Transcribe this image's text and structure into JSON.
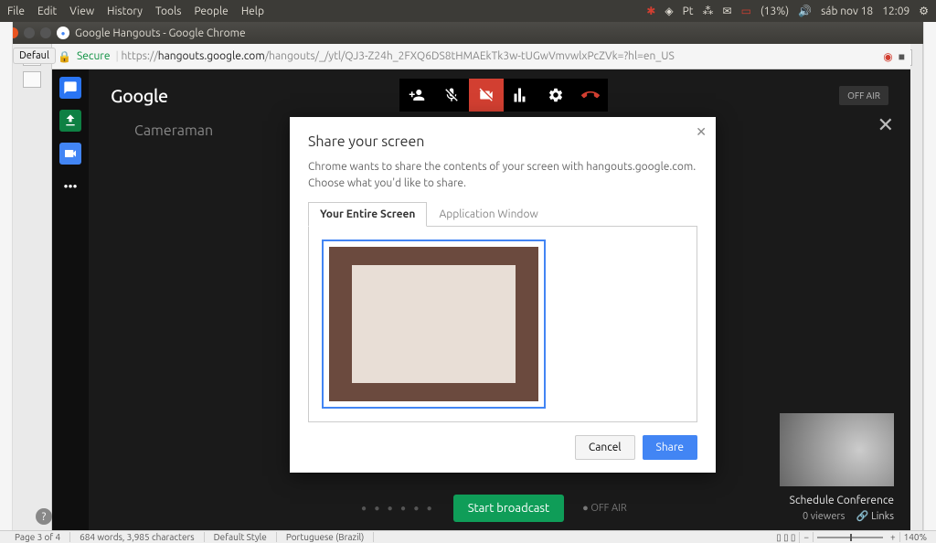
{
  "menubar": {
    "items": [
      "File",
      "Edit",
      "View",
      "History",
      "Tools",
      "People",
      "Help"
    ],
    "battery": "(13%)",
    "date": "sáb nov 18",
    "time": "12:09",
    "lang": "Pt"
  },
  "window": {
    "title": "Google Hangouts - Google Chrome"
  },
  "url": {
    "secure": "Secure",
    "prefix": "https://",
    "domain": "hangouts.google.com",
    "path": "/hangouts/_/ytl/QJ3-Z24h_2FXQ6DS8tHMAEkTk3w-tUGwVmvwlxPcZVk=?hl=en_US"
  },
  "lefttab": "Defaul",
  "app": {
    "logo": "Google",
    "offair": "OFF AIR",
    "cameraman": "Cameraman",
    "start": "Start broadcast",
    "offair2": "OFF AIR",
    "schedule": "Schedule Conference",
    "viewers": "0 viewers",
    "links": "Links"
  },
  "dialog": {
    "title": "Share your screen",
    "desc": "Chrome wants to share the contents of your screen with hangouts.google.com. Choose what you'd like to share.",
    "tab1": "Your Entire Screen",
    "tab2": "Application Window",
    "cancel": "Cancel",
    "share": "Share"
  },
  "status": {
    "page": "Page 3 of 4",
    "words": "684 words, 3,985 characters",
    "style": "Default Style",
    "lang": "Portuguese (Brazil)",
    "zoom": "140%"
  }
}
